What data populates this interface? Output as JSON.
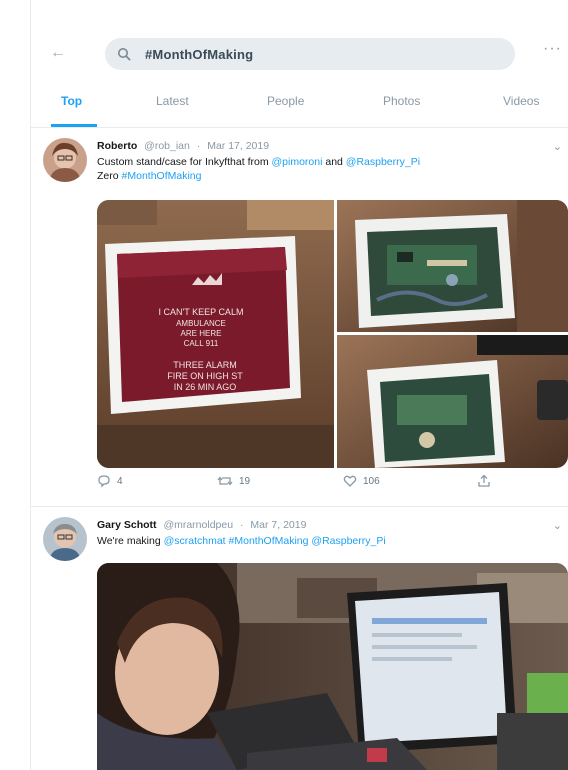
{
  "header": {
    "search_value": "#MonthOfMaking"
  },
  "tabs": [
    {
      "label": "Top"
    },
    {
      "label": "Latest"
    },
    {
      "label": "People"
    },
    {
      "label": "Photos"
    },
    {
      "label": "Videos"
    }
  ],
  "tweets": [
    {
      "name": "Roberto",
      "handle": "@rob_ian",
      "date": "Mar 17, 2019",
      "text_parts": [
        "Custom stand/case for Inkyfthat from ",
        "@pimoroni",
        " and ",
        "@Raspberry_Pi",
        " Zero ",
        "#MonthOfMaking"
      ],
      "actions": {
        "reply": "4",
        "retweet": "19",
        "like": "106"
      },
      "photo_sign_text": "I CAN'T KEEP CALM\nAMBULANCE\nARE HERE\nCALL 911\n\nTHREE ALARM\nFIRE ON HIGH ST\nIN 26 MIN AGO"
    },
    {
      "name": "Gary Schott",
      "handle": "@mrarnoldpeu",
      "date": "Mar 7, 2019",
      "text_parts": [
        "We're making ",
        "@scratchmat",
        " ",
        "#MonthOfMaking",
        " ",
        "@Raspberry_Pi"
      ]
    }
  ]
}
